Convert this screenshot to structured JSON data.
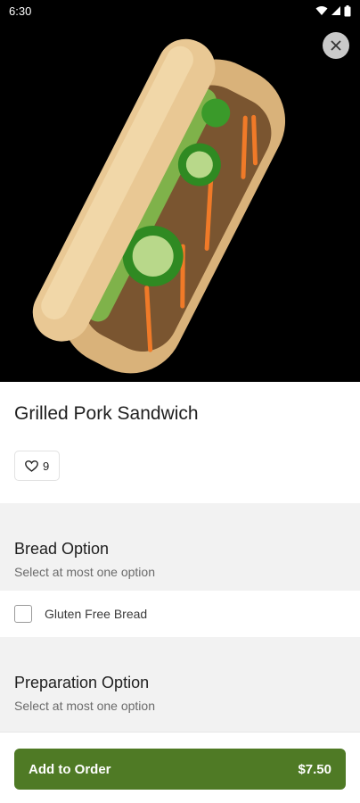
{
  "status_bar": {
    "time": "6:30"
  },
  "item": {
    "title": "Grilled Pork Sandwich",
    "likes": "9"
  },
  "sections": [
    {
      "title": "Bread Option",
      "subtitle": "Select at most one option",
      "options": [
        {
          "label": "Gluten Free Bread",
          "checked": false
        }
      ]
    },
    {
      "title": "Preparation Option",
      "subtitle": "Select at most one option"
    }
  ],
  "footer": {
    "add_label": "Add to Order",
    "price": "$7.50"
  },
  "colors": {
    "accent": "#4f7a25",
    "section_bg": "#f2f2f2",
    "hero_bg": "#000000"
  },
  "icons": [
    "wifi-icon",
    "signal-icon",
    "battery-icon",
    "close-icon",
    "heart-icon"
  ]
}
